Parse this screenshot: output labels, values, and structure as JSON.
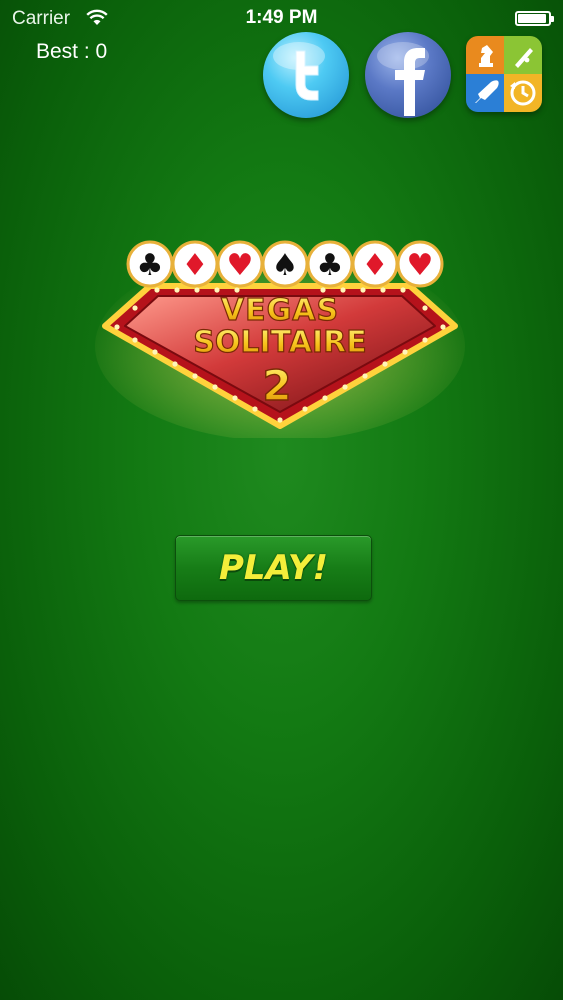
{
  "status_bar": {
    "carrier": "Carrier",
    "time": "1:49 PM"
  },
  "score": {
    "best_label": "Best : 0"
  },
  "social": {
    "twitter_icon": "twitter-bird-icon",
    "facebook_icon": "facebook-f-icon",
    "game_center_icon": "game-center-icon"
  },
  "logo": {
    "line1": "VEGAS",
    "line2": "SOLITAIRE",
    "line3": "2",
    "suits": [
      "♣",
      "♦",
      "♥",
      "♠",
      "♣",
      "♦",
      "♥"
    ]
  },
  "play": {
    "label": "PLAY!"
  },
  "colors": {
    "felt_green": "#137a13",
    "play_text": "#f4ee3a",
    "sign_red": "#c8222b",
    "title_gold": "#f6c21a"
  }
}
